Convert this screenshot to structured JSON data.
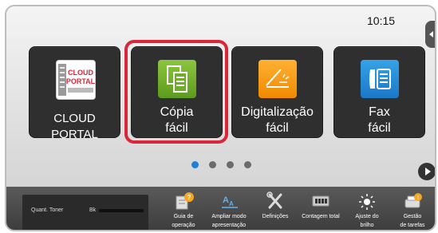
{
  "status": {
    "time": "10:15"
  },
  "tiles": [
    {
      "id": "cloud",
      "icon": "cloud-portal-icon",
      "label_lines": [
        "CLOUD PORTAL"
      ],
      "icon_text": [
        "CLOUD",
        "PORTAL"
      ]
    },
    {
      "id": "copy",
      "icon": "easy-copy-icon",
      "label_lines": [
        "Cópia",
        "fácil"
      ],
      "selected": true
    },
    {
      "id": "scan",
      "icon": "easy-scan-icon",
      "label_lines": [
        "Digitalização",
        "fácil"
      ]
    },
    {
      "id": "fax",
      "icon": "easy-fax-icon",
      "label_lines": [
        "Fax",
        "fácil"
      ]
    }
  ],
  "pager": {
    "pages": 4,
    "current": 1
  },
  "colors": {
    "highlight": "#d9263a",
    "active_dot": "#1e7fd6",
    "copy_icon": "#6fae2a",
    "scan_icon": "#f7a21b",
    "fax_icon": "#2a8fdc"
  },
  "toner": {
    "title": "Quant. Toner",
    "channel": "Bk",
    "level": 1.0
  },
  "bottom_bar": [
    {
      "icon": "operation-guide-icon",
      "label_lines": [
        "Guia de",
        "operação"
      ]
    },
    {
      "icon": "enlarge-display-icon",
      "label_lines": [
        "Ampliar modo",
        "apresentação"
      ]
    },
    {
      "icon": "settings-tools-icon",
      "label_lines": [
        "Definições"
      ]
    },
    {
      "icon": "total-count-icon",
      "label_lines": [
        "Contagem total"
      ]
    },
    {
      "icon": "brightness-icon",
      "label_lines": [
        "Ajuste do",
        "brilho"
      ]
    },
    {
      "icon": "job-status-icon",
      "label_lines": [
        "Gestão",
        "de tarefas"
      ]
    }
  ]
}
